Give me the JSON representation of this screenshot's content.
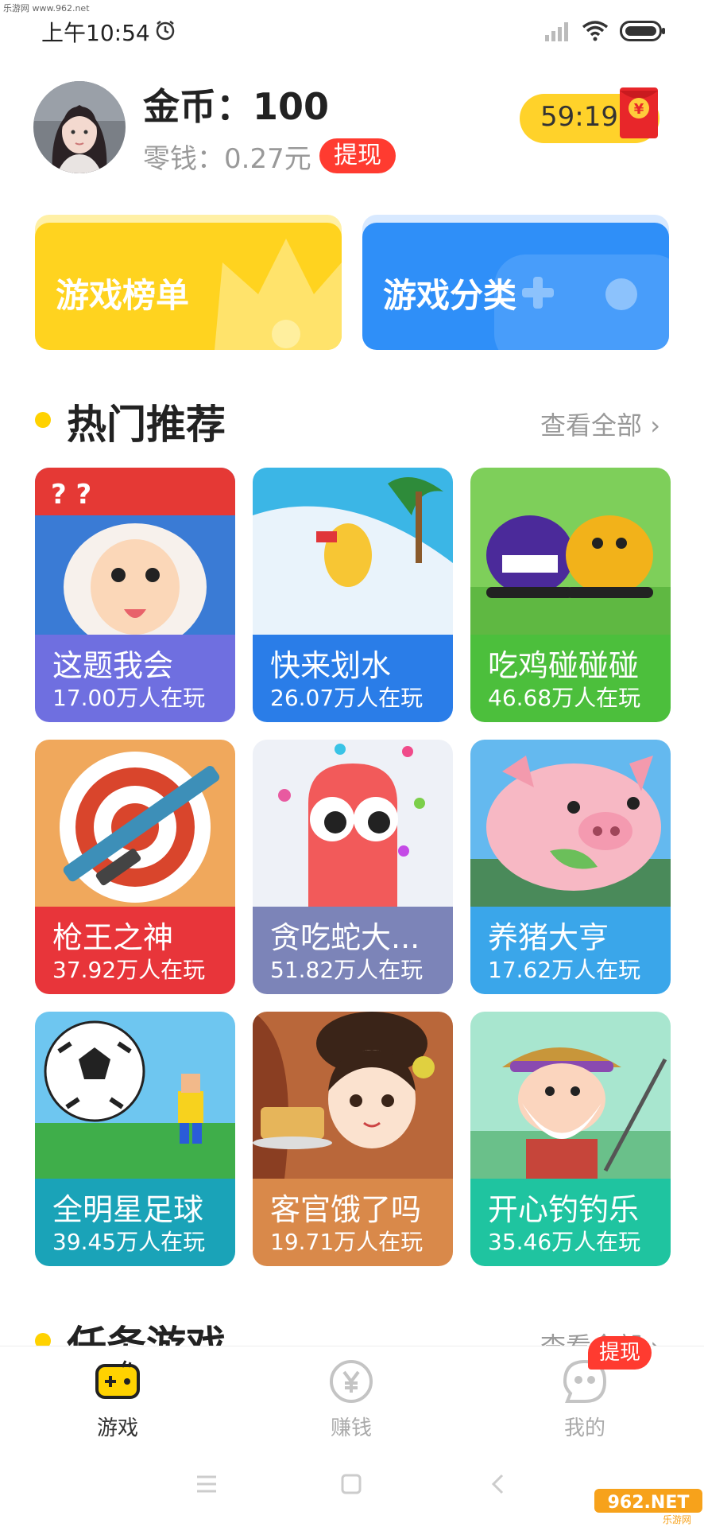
{
  "watermark": {
    "top_text": "乐游网 www.962.net",
    "logo_text": "962.NET",
    "logo_sub": "乐游网"
  },
  "status_bar": {
    "time": "上午10:54"
  },
  "header": {
    "coins_label": "金币：100",
    "change_label": "零钱：0.27元",
    "withdraw_label": "提现",
    "timer": "59:19",
    "redpacket_symbol": "¥"
  },
  "banners": [
    {
      "label": "游戏榜单",
      "color": "#ffd31f"
    },
    {
      "label": "游戏分类",
      "color": "#2f8ff8"
    }
  ],
  "hot_section": {
    "title": "热门推荐",
    "view_all": "查看全部"
  },
  "task_section": {
    "title": "任务游戏",
    "view_all": "查看全部"
  },
  "games": [
    {
      "name": "这题我会",
      "players": "17.00万人在玩",
      "color": "#6f6fe0"
    },
    {
      "name": "快来划水",
      "players": "26.07万人在玩",
      "color": "#2a7de8"
    },
    {
      "name": "吃鸡碰碰碰",
      "players": "46.68万人在玩",
      "color": "#4cbf3c"
    },
    {
      "name": "枪王之神",
      "players": "37.92万人在玩",
      "color": "#e8353a"
    },
    {
      "name": "贪吃蛇大...",
      "players": "51.82万人在玩",
      "color": "#7c84b8"
    },
    {
      "name": "养猪大亨",
      "players": "17.62万人在玩",
      "color": "#3aa6ea"
    },
    {
      "name": "全明星足球",
      "players": "39.45万人在玩",
      "color": "#1aa3b8"
    },
    {
      "name": "客官饿了吗",
      "players": "19.71万人在玩",
      "color": "#d9894a"
    },
    {
      "name": "开心钓钓乐",
      "players": "35.46万人在玩",
      "color": "#1fc4a0"
    }
  ],
  "bottom_nav": {
    "items": [
      {
        "label": "游戏",
        "icon": "gamepad-icon",
        "active": true
      },
      {
        "label": "赚钱",
        "icon": "yuan-coin-icon",
        "active": false
      },
      {
        "label": "我的",
        "icon": "face-icon",
        "active": false
      }
    ],
    "badge": "提现"
  },
  "colors": {
    "accent": "#ffd200",
    "red": "#ff3b30",
    "blue": "#2f8ff8"
  }
}
